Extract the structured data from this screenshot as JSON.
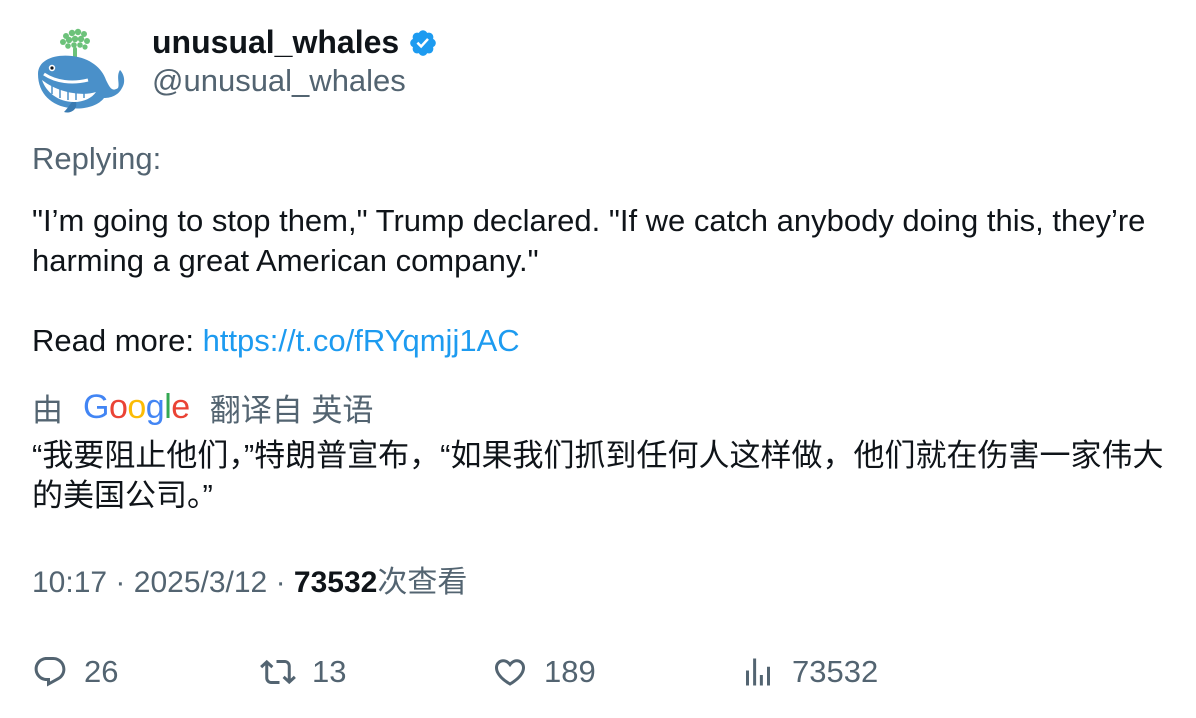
{
  "author": {
    "display_name": "unusual_whales",
    "handle": "@unusual_whales",
    "verified_icon": "verified-badge-icon",
    "avatar_icon": "whale-avatar-icon",
    "colors": {
      "verified": "#1d9bf0",
      "handle": "#536471"
    }
  },
  "tweet": {
    "replying_label": "Replying:",
    "text": "\"I’m going to stop them,\" Trump declared. \"If we catch anybody doing this, they’re harming a great American company.\"",
    "read_more_label": "Read more:",
    "link": "https://t.co/fRYqmjj1AC",
    "link_color": "#1d9bf0"
  },
  "translation": {
    "prefix": "由",
    "provider": "Google",
    "suffix": "翻译自 英语",
    "text": "“我要阻止他们，”特朗普宣布，“如果我们抓到任何人这样做，他们就在伤害一家伟大的美国公司。”"
  },
  "meta": {
    "time": "10:17",
    "separator": "·",
    "date": "2025/3/12",
    "views_count": "73532",
    "views_label": "次查看"
  },
  "actions": {
    "replies": {
      "icon": "reply-icon",
      "count": "26"
    },
    "retweets": {
      "icon": "retweet-icon",
      "count": "13"
    },
    "likes": {
      "icon": "heart-icon",
      "count": "189"
    },
    "views": {
      "icon": "views-chart-icon",
      "count": "73532"
    }
  }
}
